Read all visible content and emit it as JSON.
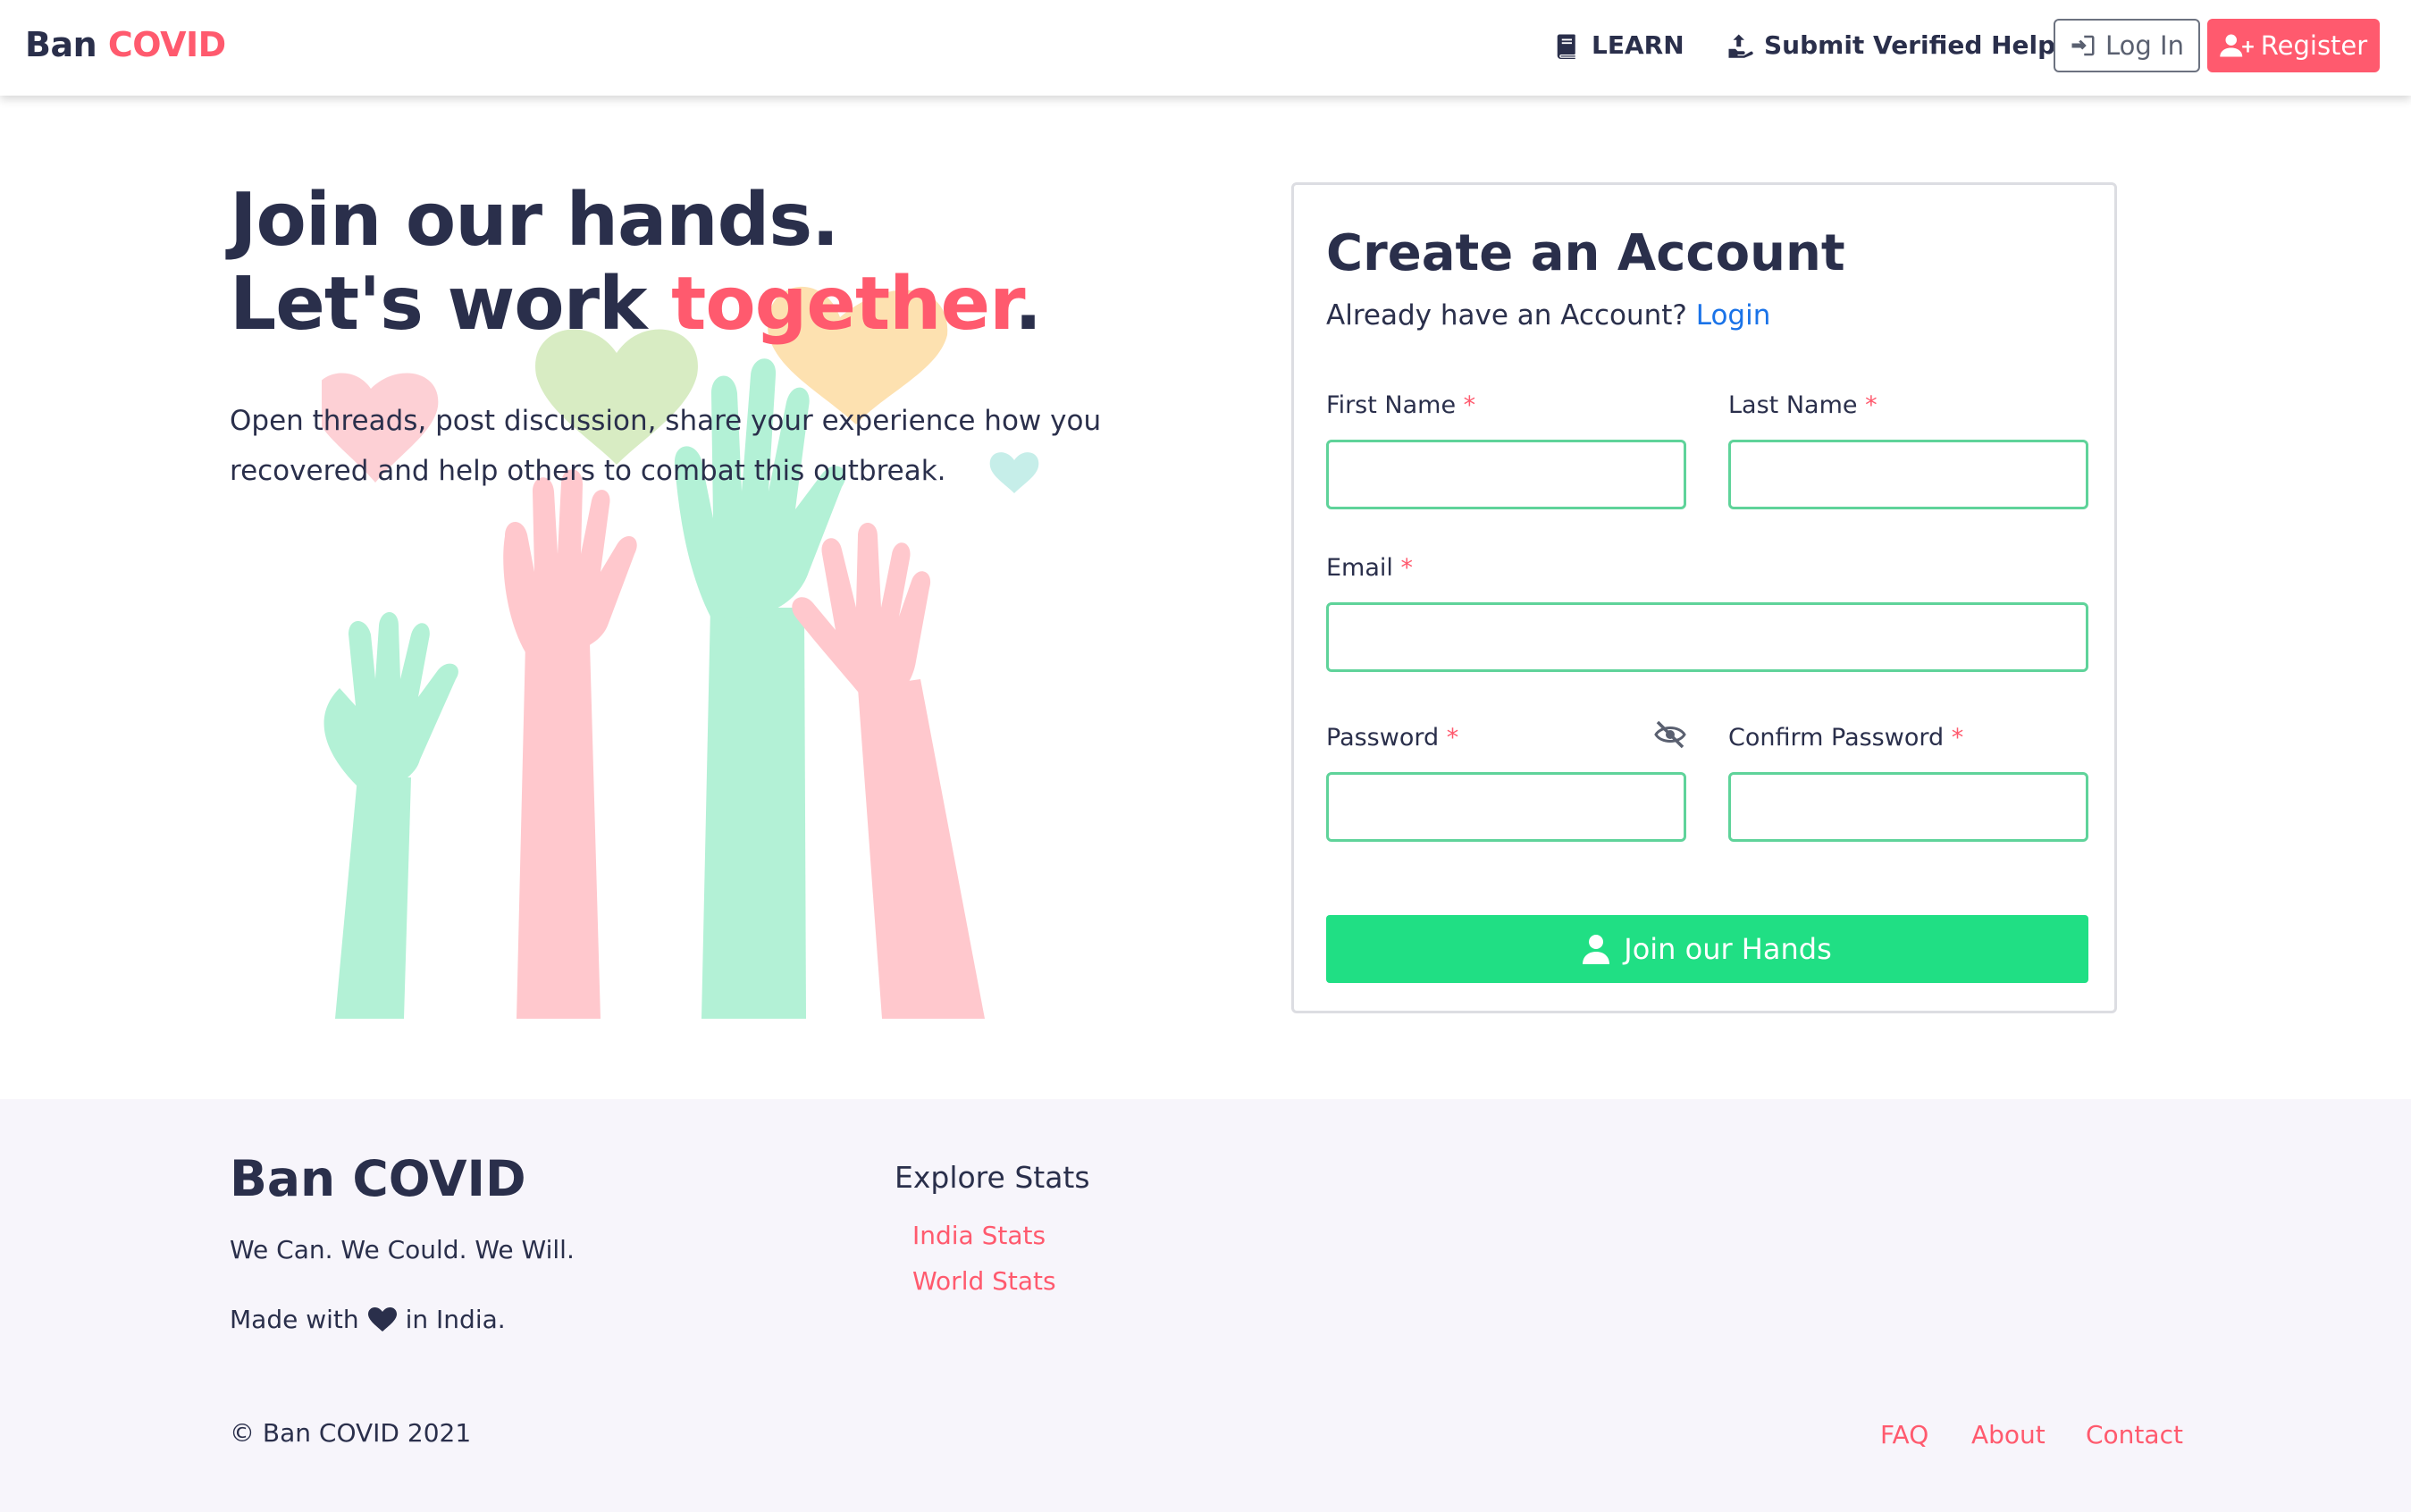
{
  "nav": {
    "brand_part1": "Ban",
    "brand_part2": "COVID",
    "learn_label": "LEARN",
    "submit_label": "Submit Verified Help",
    "login_label": "Log In",
    "register_label": "Register"
  },
  "hero": {
    "title_line1": "Join our hands.",
    "title_line2_prefix": "Let's work ",
    "title_line2_accent": "together",
    "title_line2_suffix": ".",
    "description": "Open threads, post discussion, share your experience how you recovered and help others to combat this outbreak."
  },
  "form": {
    "title": "Create an Account",
    "subtitle": "Already have an Account?",
    "login_link": "Login",
    "required_mark": "*",
    "first_name_label": "First Name",
    "last_name_label": "Last Name",
    "email_label": "Email",
    "password_label": "Password",
    "confirm_password_label": "Confirm Password",
    "first_name_value": "",
    "last_name_value": "",
    "email_value": "",
    "password_value": "",
    "confirm_password_value": "",
    "submit_label": "Join our Hands"
  },
  "footer": {
    "brand": "Ban COVID",
    "tagline": "We Can. We Could. We Will.",
    "made_prefix": "Made with",
    "made_suffix": "in India.",
    "explore_heading": "Explore Stats",
    "explore_links": [
      "India Stats",
      "World Stats"
    ],
    "copyright": "© Ban COVID 2021",
    "bottom_links": [
      "FAQ",
      "About",
      "Contact"
    ]
  },
  "colors": {
    "accent": "#ff5a6e",
    "primary_text": "#2a2f4b",
    "success": "#20df84",
    "link": "#1a73e8"
  },
  "icons": {
    "learn": "book-icon",
    "submit": "hand-upload-icon",
    "login": "sign-in-icon",
    "register": "user-plus-icon",
    "password_toggle": "eye-slash-icon",
    "join": "user-icon",
    "made_with": "heart-icon"
  }
}
